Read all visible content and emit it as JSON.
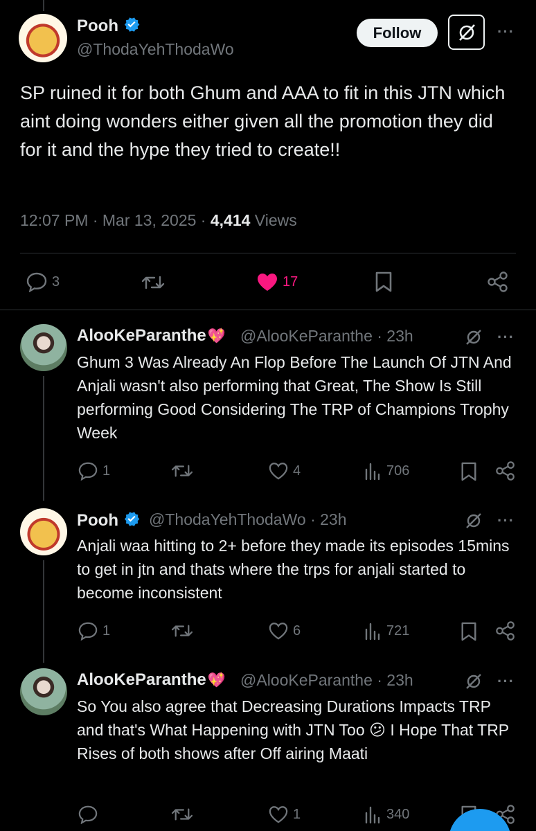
{
  "main_post": {
    "author_name": "Pooh",
    "author_handle": "@ThodaYehThodaWo",
    "follow_label": "Follow",
    "more_label": "···",
    "text": "SP ruined it for both Ghum and AAA to fit in this JTN which aint doing wonders either given all the promotion they did for it and the hype they tried to create!!",
    "time": "12:07 PM · Mar 13, 2025 · ",
    "views_count": "4,414",
    "views_label": " Views",
    "replies": "3",
    "likes": "17"
  },
  "replies": [
    {
      "author_name": "AlooKeParanthe",
      "badge": "💖",
      "meta": "@AlooKeParanthe · 23h",
      "text": "Ghum 3 Was Already An Flop Before The Launch Of JTN And Anjali wasn't also performing that Great, The Show Is Still performing Good Considering The TRP of Champions Trophy Week",
      "replies": "1",
      "likes": "4",
      "views": "706"
    },
    {
      "author_name": "Pooh",
      "meta": "@ThodaYehThodaWo · 23h",
      "text": "Anjali waa hitting to 2+ before they made its episodes 15mins to get in jtn and thats where the trps for anjali started to become inconsistent",
      "replies": "1",
      "likes": "6",
      "views": "721"
    },
    {
      "author_name": "AlooKeParanthe",
      "badge": "💖",
      "meta": "@AlooKeParanthe · 23h",
      "text_before": "So You also agree that Decreasing Durations Impacts TRP and that's What Happening with JTN Too ",
      "emoji": "😕",
      "text_after": " I Hope That TRP Rises of both shows after Off airing Maati",
      "replies": "",
      "likes": "1",
      "views": "340"
    }
  ],
  "colors": {
    "background": "#000000",
    "text": "#e7e9ea",
    "secondary": "#71767b",
    "like": "#f91880",
    "verified": "#1d9bf0"
  },
  "icons": [
    "verified-badge-icon",
    "grok-icon",
    "more-icon",
    "reply-icon",
    "retweet-icon",
    "like-icon",
    "bookmark-icon",
    "share-icon",
    "views-icon"
  ]
}
